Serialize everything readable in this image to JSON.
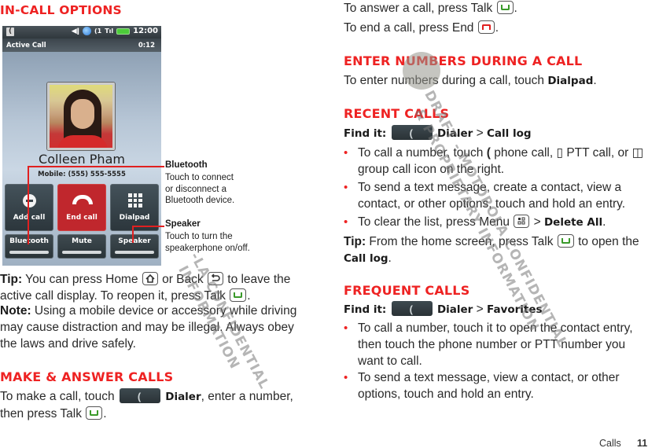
{
  "left_column": {
    "in_call_heading": "In-call options",
    "phone": {
      "status_time": "12:00",
      "status_icons": [
        "notification-icon",
        "speaker-icon",
        "globe-icon",
        "call-signal-icon",
        "signal-bars-icon",
        "battery-icon"
      ],
      "call_title": "Active Call",
      "call_timer": "0:12",
      "contact_name": "Colleen Pham",
      "contact_number": "Mobile:  (555) 555-5555",
      "buttons": [
        {
          "label": "Add call",
          "icon": "add-call-icon"
        },
        {
          "label": "End call",
          "icon": "end-call-icon"
        },
        {
          "label": "Dialpad",
          "icon": "dialpad-icon"
        },
        {
          "label": "Bluetooth"
        },
        {
          "label": "Mute"
        },
        {
          "label": "Speaker"
        }
      ]
    },
    "callouts": {
      "bluetooth_title": "Bluetooth",
      "bluetooth_text": [
        "Touch to connect",
        "or disconnect a",
        "Bluetooth device."
      ],
      "speaker_title": "Speaker",
      "speaker_text": [
        "Touch to turn the",
        "speakerphone on/off."
      ]
    },
    "tip": {
      "label": "Tip:",
      "part1": " You can press Home ",
      "part2": " or Back ",
      "part3": " to leave the active call display. To reopen it, press Talk ",
      "part4": "."
    },
    "note": {
      "label": "Note:",
      "text": " Using a mobile device or accessory while driving may cause distraction and may be illegal. Always obey the laws and drive safely."
    },
    "make_answer_heading": "Make & answer calls",
    "make_call": {
      "part1": "To make a call, touch ",
      "dialer": "Dialer",
      "part2": ", enter a number, then press Talk ",
      "part3": "."
    }
  },
  "right_column": {
    "answer_text": "To answer a call, press Talk ",
    "end_text": "To end a call, press End ",
    "period": ".",
    "enter_numbers_heading": "Enter numbers during a call",
    "enter_numbers_text": "To enter numbers during a call, touch ",
    "dialpad": "Dialpad",
    "recent_heading": "Recent calls",
    "recent_find": {
      "label": "Find it:",
      "dialer": "Dialer",
      "sep": ">",
      "target": "Call log"
    },
    "recent_bullets": [
      {
        "a": "To call a number, touch ",
        "b": " phone call, ",
        "c": " PTT call, or ",
        "d": " group call icon on the right."
      },
      {
        "a": "To send a text message, create a contact, view a contact, or other options, touch and hold an entry."
      },
      {
        "a": "To clear the list, press Menu ",
        "b": " > ",
        "bold": "Delete All",
        "c": "."
      }
    ],
    "recent_tip": {
      "label": "Tip:",
      "a": " From the home screen, press Talk ",
      "b": " to open the ",
      "bold": "Call log",
      "c": "."
    },
    "frequent_heading": "Frequent calls",
    "frequent_find": {
      "label": "Find it:",
      "dialer": "Dialer",
      "sep": ">",
      "target": "Favorites"
    },
    "frequent_bullets": [
      "To call a number, touch it to open the contact entry, then touch the phone number or PTT number you want to call.",
      "To send a text message, view a contact, or other options, touch and hold an entry."
    ]
  },
  "watermark": {
    "left": [
      "-LA CONFIDENTIAL",
      "INFORMATION"
    ],
    "right": [
      "DRAFT - MOTOROLA CONFIDENTIAL",
      "& PROPRIETARY INFORMATION"
    ]
  },
  "footer": {
    "section": "Calls",
    "page_number": "11"
  },
  "colors": {
    "heading_red": "#ee2222",
    "talk_green": "#3a9a2a",
    "end_red": "#e02020"
  }
}
